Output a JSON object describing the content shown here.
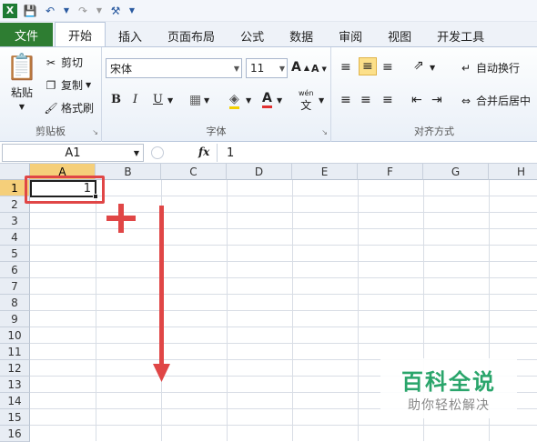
{
  "tabs": [
    "文件",
    "开始",
    "插入",
    "页面布局",
    "公式",
    "数据",
    "审阅",
    "视图",
    "开发工具"
  ],
  "clipboard": {
    "paste": "粘贴",
    "cut": "剪切",
    "copy": "复制",
    "format_painter": "格式刷",
    "label": "剪贴板"
  },
  "font": {
    "name": "宋体",
    "size": "11",
    "bold": "B",
    "italic": "I",
    "underline": "U",
    "label": "字体",
    "wen": "wén",
    "wen_char": "文"
  },
  "alignment": {
    "wrap": "自动换行",
    "merge": "合并后居中",
    "label": "对齐方式"
  },
  "formula_bar": {
    "name_box": "A1",
    "fx": "fx",
    "value": "1"
  },
  "columns": [
    "A",
    "B",
    "C",
    "D",
    "E",
    "F",
    "G",
    "H"
  ],
  "rows": [
    "1",
    "2",
    "3",
    "4",
    "5",
    "6",
    "7",
    "8",
    "9",
    "10",
    "11",
    "12",
    "13",
    "14",
    "15",
    "16"
  ],
  "cells": {
    "A1": "1"
  },
  "watermark": {
    "title": "百科全说",
    "subtitle": "助你轻松解决"
  },
  "colors": {
    "file_tab": "#2e7d32",
    "selection": "#1f1f1f",
    "annotation": "#e04646",
    "header_highlight": "#f5cf7a"
  }
}
